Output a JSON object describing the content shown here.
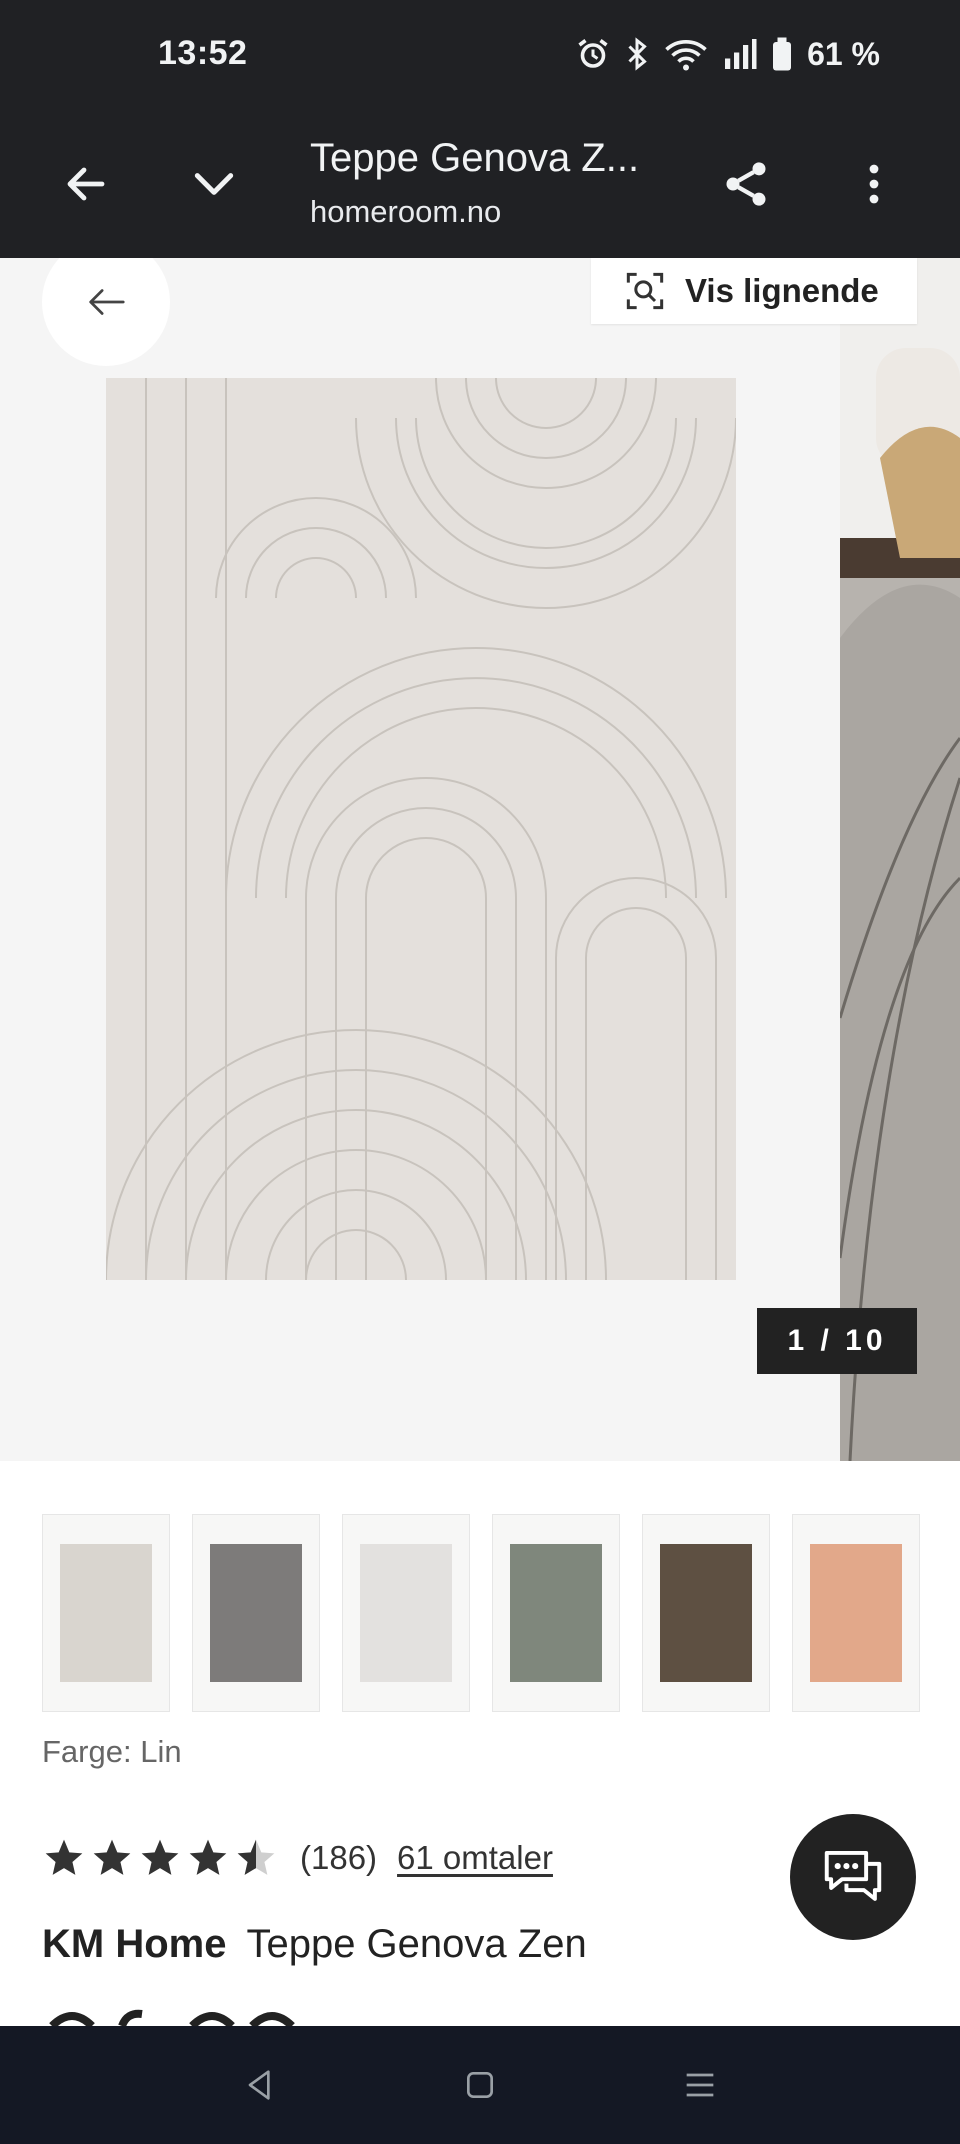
{
  "status_bar": {
    "time": "13:52",
    "battery": "61 %",
    "icons": [
      "alarm-icon",
      "bluetooth-icon",
      "wifi-icon",
      "signal-icon",
      "battery-icon"
    ]
  },
  "toolbar": {
    "title": "Teppe Genova Z...",
    "url": "homeroom.no"
  },
  "gallery": {
    "similar_label": "Vis lignende",
    "counter": "1 / 10"
  },
  "swatches": [
    {
      "name": "Lin",
      "color": "#d9d5cf"
    },
    {
      "name": "grey",
      "color": "#7d7b7a"
    },
    {
      "name": "white",
      "color": "#e3e1df"
    },
    {
      "name": "green",
      "color": "#7f877c"
    },
    {
      "name": "brown",
      "color": "#5e5042"
    },
    {
      "name": "peach",
      "color": "#e2a88a"
    }
  ],
  "color_label": "Farge: Lin",
  "rating": {
    "value": 4.5,
    "max": 5,
    "count": "(186)",
    "reviews_link": "61 omtaler"
  },
  "product": {
    "brand": "KM Home",
    "name": "Teppe Genova Zen"
  },
  "colors": {
    "chrome": "#202124",
    "nav": "#141824",
    "rug": "#e4e0dc"
  }
}
